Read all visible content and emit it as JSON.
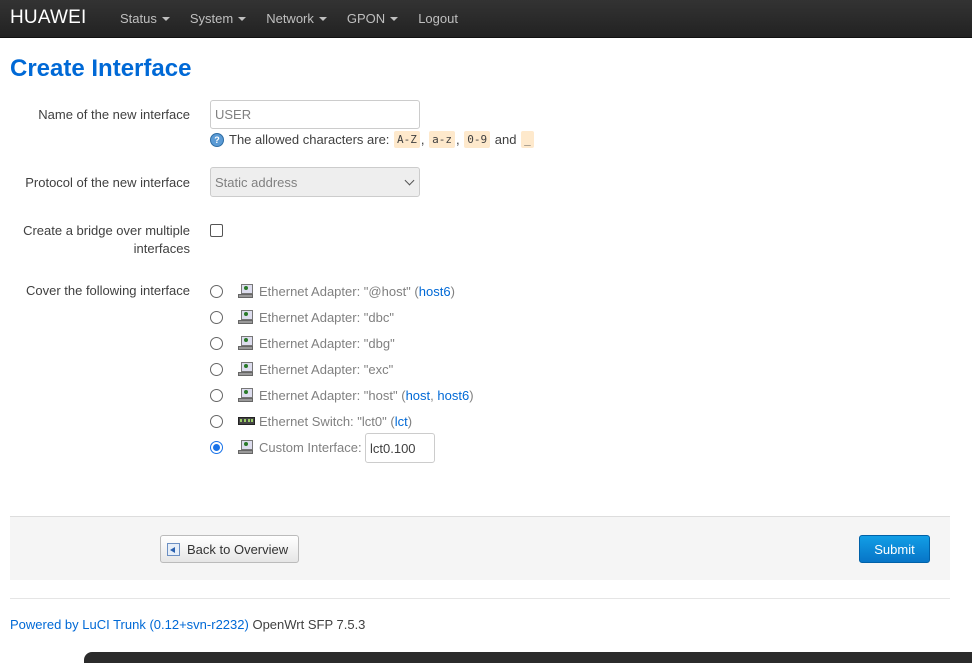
{
  "navbar": {
    "brand": "HUAWEI",
    "items": [
      {
        "label": "Status",
        "has_caret": true
      },
      {
        "label": "System",
        "has_caret": true
      },
      {
        "label": "Network",
        "has_caret": true
      },
      {
        "label": "GPON",
        "has_caret": true
      },
      {
        "label": "Logout",
        "has_caret": false
      }
    ]
  },
  "page": {
    "title": "Create Interface"
  },
  "form": {
    "name": {
      "label": "Name of the new interface",
      "value": "",
      "placeholder": "USER",
      "hint_prefix": "The allowed characters are:",
      "hint_codes": [
        "A-Z",
        "a-z",
        "0-9",
        "_"
      ],
      "hint_and": "and"
    },
    "protocol": {
      "label": "Protocol of the new interface",
      "selected": "Static address"
    },
    "bridge": {
      "label_line1": "Create a bridge over multiple",
      "label_line2": "interfaces",
      "checked": false
    },
    "cover": {
      "label": "Cover the following interface",
      "options": [
        {
          "text": "Ethernet Adapter: \"@host\"",
          "links": [
            "host6"
          ],
          "icon": "ethernet-icon",
          "checked": false
        },
        {
          "text": "Ethernet Adapter: \"dbc\"",
          "links": [],
          "icon": "ethernet-icon",
          "checked": false
        },
        {
          "text": "Ethernet Adapter: \"dbg\"",
          "links": [],
          "icon": "ethernet-icon",
          "checked": false
        },
        {
          "text": "Ethernet Adapter: \"exc\"",
          "links": [],
          "icon": "ethernet-icon",
          "checked": false
        },
        {
          "text": "Ethernet Adapter: \"host\"",
          "links": [
            "host",
            "host6"
          ],
          "icon": "ethernet-icon",
          "checked": false
        },
        {
          "text": "Ethernet Switch: \"lct0\"",
          "links": [
            "lct"
          ],
          "icon": "switch-icon",
          "checked": false
        },
        {
          "text": "Custom Interface:",
          "links": [],
          "icon": "ethernet-icon",
          "checked": true,
          "custom_value": "lct0.100"
        }
      ]
    }
  },
  "actions": {
    "back_label": "Back to Overview",
    "submit_label": "Submit"
  },
  "footer": {
    "link_text": "Powered by LuCI Trunk (0.12+svn-r2232)",
    "text": "OpenWrt SFP 7.5.3"
  },
  "colors": {
    "accent": "#0069d6",
    "navbar": "#222222",
    "submit": "#0775c7"
  }
}
